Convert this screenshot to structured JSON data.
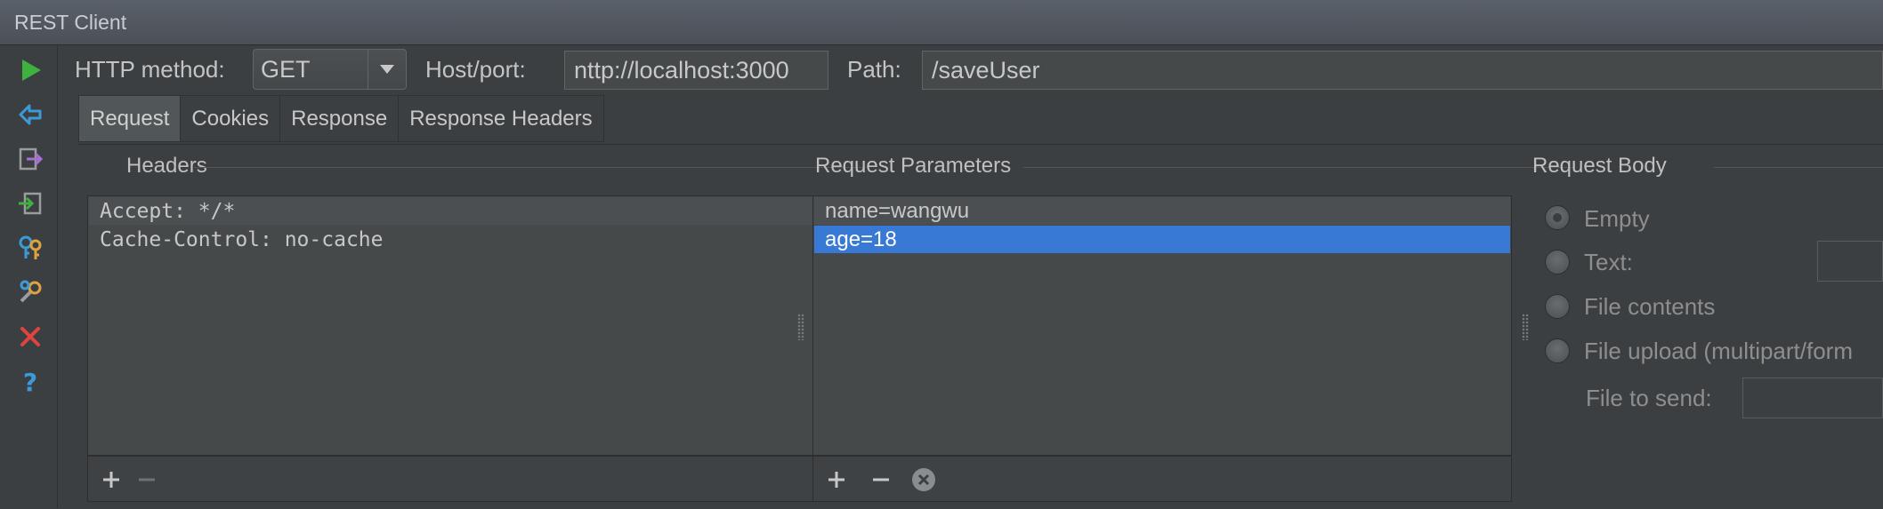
{
  "window": {
    "title": "REST Client"
  },
  "toolbar": {
    "http_method_label": "HTTP method:",
    "http_method_value": "GET",
    "host_label": "Host/port:",
    "host_value": "nttp://localhost:3000",
    "path_label": "Path:",
    "path_value": "/saveUser"
  },
  "tool_icons": [
    "run-icon",
    "import-icon",
    "export-to-file-icon",
    "import-from-file-icon",
    "keys-icon",
    "settings-icon",
    "close-icon",
    "help-icon"
  ],
  "tabs": [
    {
      "label": "Request",
      "active": true
    },
    {
      "label": "Cookies"
    },
    {
      "label": "Response"
    },
    {
      "label": "Response Headers"
    }
  ],
  "headers": {
    "title": "Headers",
    "rows": [
      "Accept: */*",
      "Cache-Control: no-cache"
    ]
  },
  "request_params": {
    "title": "Request Parameters",
    "rows": [
      "name=wangwu",
      "age=18"
    ]
  },
  "request_body": {
    "title": "Request Body",
    "options": [
      {
        "label": "Empty",
        "checked": true
      },
      {
        "label": "Text:"
      },
      {
        "label": "File contents"
      },
      {
        "label": "File upload (multipart/form"
      }
    ],
    "file_to_send_label": "File to send:"
  },
  "colors": {
    "selection": "#3979d6",
    "run_green": "#3fb13f",
    "close_red": "#e0443e",
    "help_blue": "#3d9ad8"
  }
}
